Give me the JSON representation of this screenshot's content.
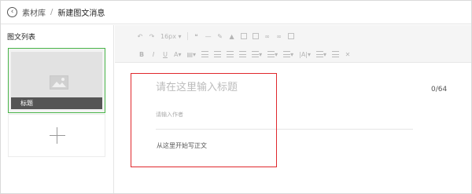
{
  "header": {
    "back_label": "素材库",
    "separator": "/",
    "current_label": "新建图文消息"
  },
  "left_panel": {
    "title": "图文列表",
    "cards": [
      {
        "caption": "标题",
        "selected": true
      }
    ],
    "add_button_symbol": "+"
  },
  "toolbar": {
    "row1": [
      "undo-icon",
      "redo-icon",
      "16px",
      "quote-icon",
      "hr-icon",
      "format-brush-icon",
      "stamp-icon",
      "image-icon",
      "table-icon",
      "link-icon",
      "unlink-icon",
      "video-icon"
    ],
    "font_size": "16px",
    "row2": [
      "bold-icon",
      "italic-icon",
      "underline-icon",
      "font-color-icon",
      "background-color-icon",
      "align-left-icon",
      "align-center-icon",
      "align-right-icon",
      "justify-icon",
      "indent-icon",
      "paragraph-spacing-icon",
      "line-height-icon",
      "list-icon",
      "clear-format-icon",
      "fullscreen-icon"
    ]
  },
  "editor": {
    "title_placeholder": "请在这里输入标题",
    "title_counter": "0/64",
    "author_placeholder": "请输入作者",
    "body_placeholder": "从这里开始写正文"
  },
  "colors": {
    "selected_border": "#48b448",
    "highlight": "#e0282d",
    "caption_bg": "#555555"
  }
}
